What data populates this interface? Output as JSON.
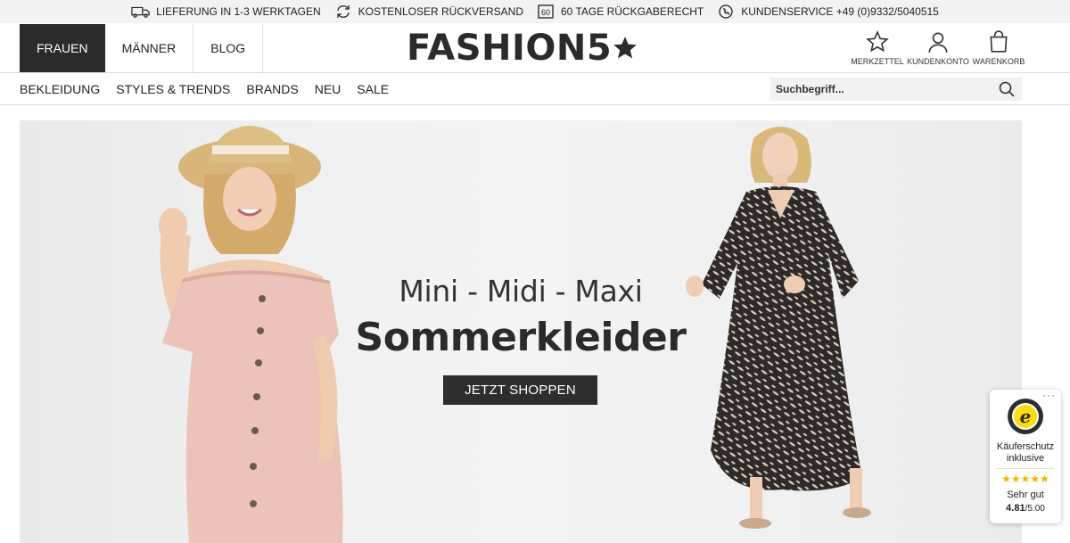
{
  "topbar": {
    "usps": [
      {
        "icon": "delivery-truck-icon",
        "text": "LIEFERUNG IN 1-3 WERKTAGEN"
      },
      {
        "icon": "return-arrows-icon",
        "text": "KOSTENLOSER RÜCKVERSAND"
      },
      {
        "icon": "60-days-icon",
        "icon_text": "60",
        "text": "60 TAGE RÜCKGABERECHT"
      },
      {
        "icon": "phone-chat-icon",
        "text": "KUNDENSERVICE +49 (0)9332/5040515"
      }
    ]
  },
  "header": {
    "gender_tabs": [
      "FRAUEN",
      "MÄNNER",
      "BLOG"
    ],
    "active_tab": "FRAUEN",
    "logo_text": "FASHION5",
    "actions": [
      {
        "icon": "star-icon",
        "label": "MERKZETTEL"
      },
      {
        "icon": "user-icon",
        "label": "KUNDENKONTO"
      },
      {
        "icon": "shopping-bag-icon",
        "label": "WARENKORB"
      }
    ]
  },
  "catnav": {
    "items": [
      "BEKLEIDUNG",
      "STYLES & TRENDS",
      "BRANDS",
      "NEU",
      "SALE"
    ],
    "search_placeholder": "Suchbegriff..."
  },
  "hero": {
    "subtitle": "Mini - Midi - Maxi",
    "title": "Sommerkleider",
    "cta": "JETZT SHOPPEN"
  },
  "trust_badge": {
    "protection_line1": "Käuferschutz",
    "protection_line2": "inklusive",
    "stars": "★★★★★",
    "grade": "Sehr gut",
    "score": "4.81",
    "score_max": "/5.00",
    "rating_value": 4.81,
    "star_color": "#f4b400"
  },
  "colors": {
    "accent_dark": "#2b2b2b",
    "topbar_bg": "#f3f3f3"
  }
}
